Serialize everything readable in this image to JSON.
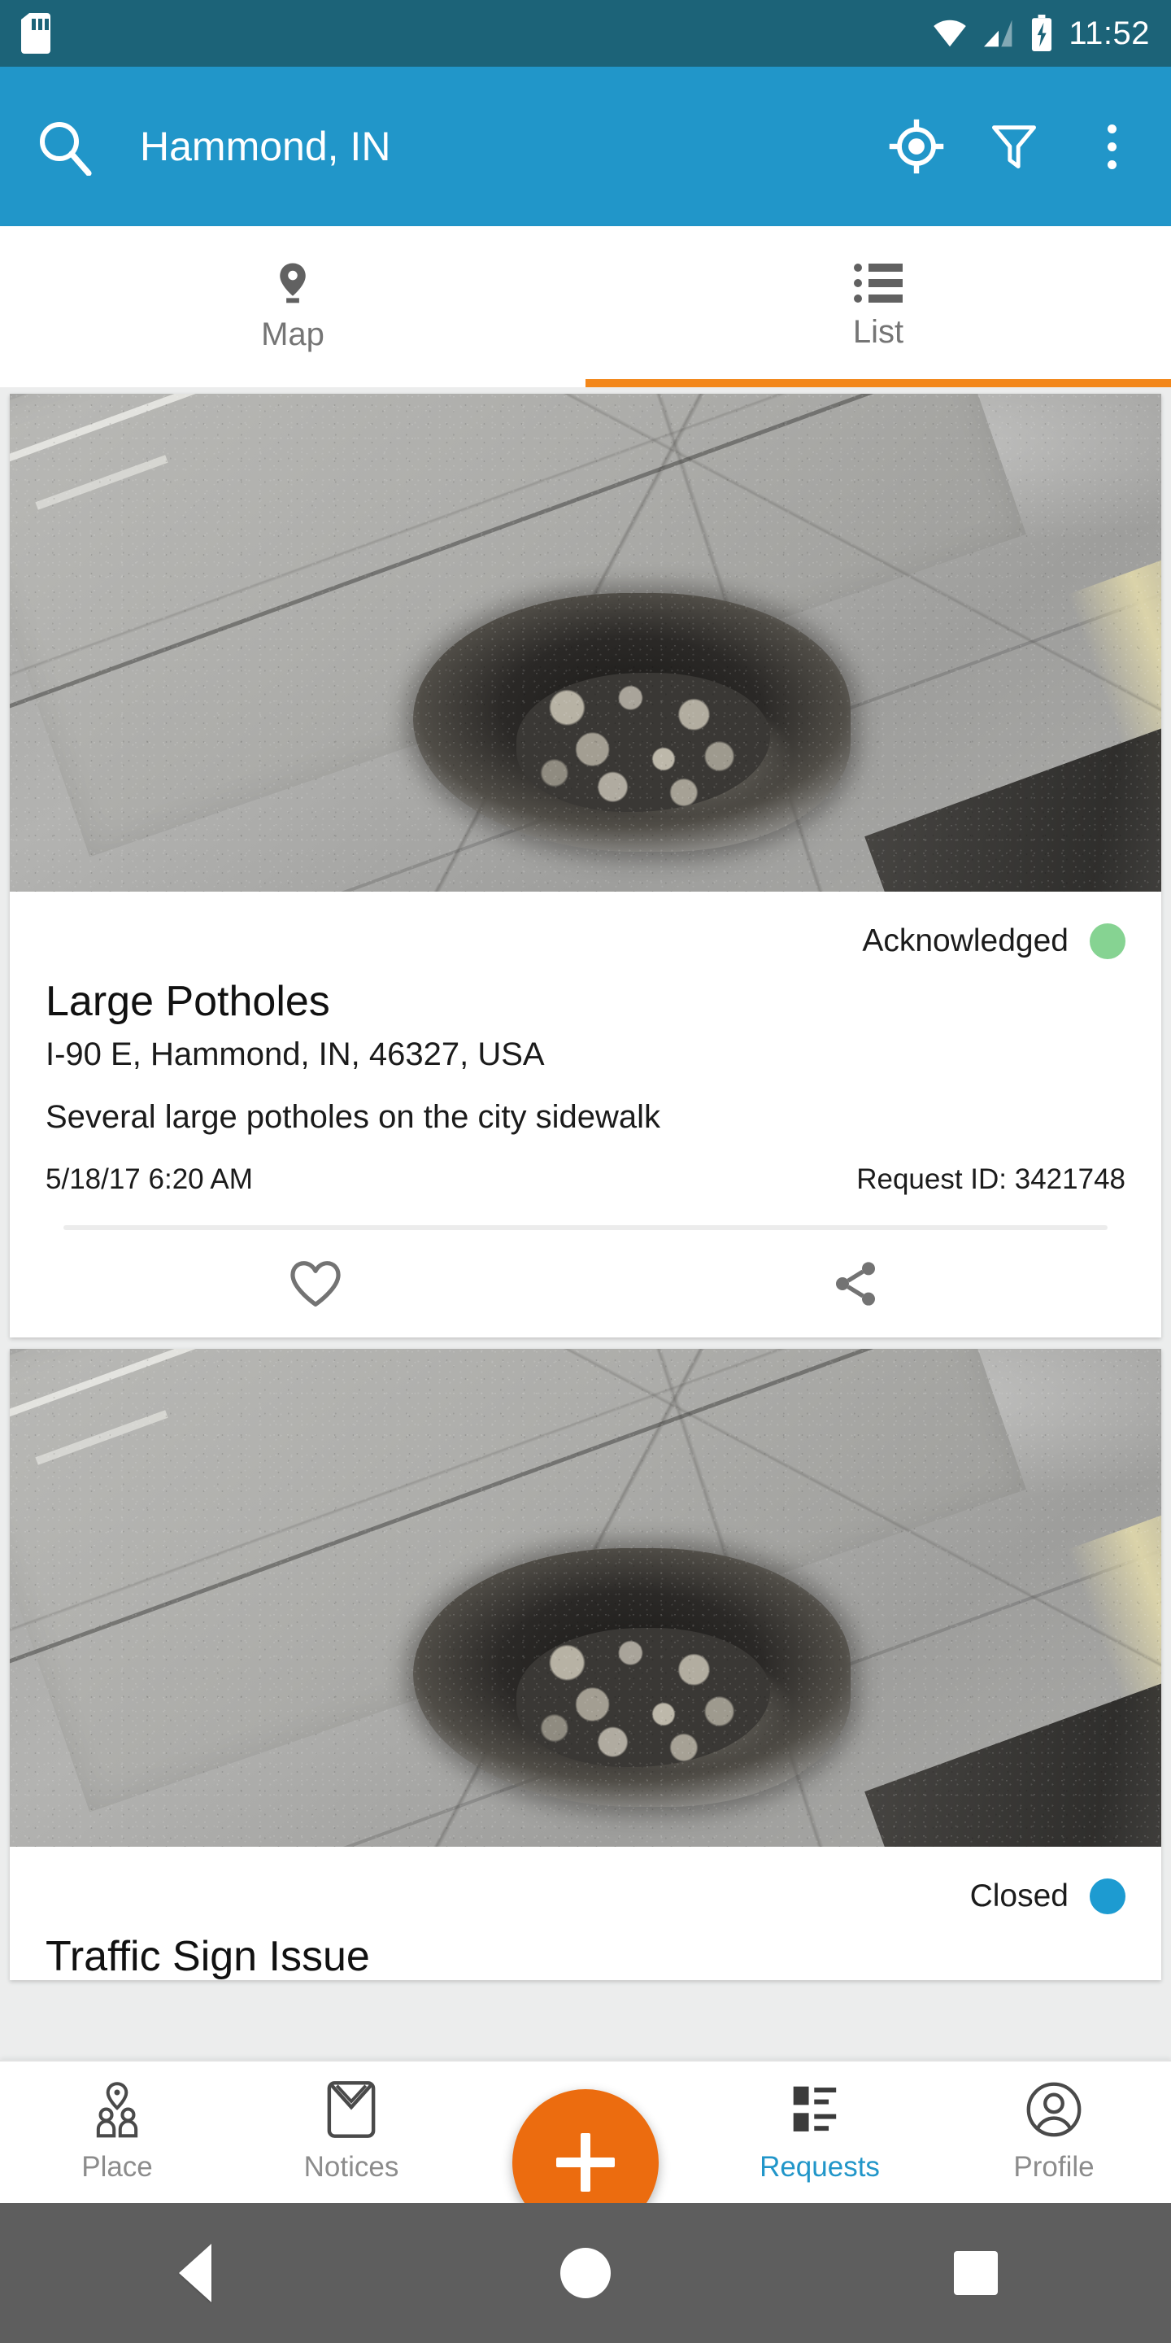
{
  "status_bar": {
    "time": "11:52",
    "icons": [
      "sd-card-icon",
      "wifi-icon",
      "cellular-signal-icon",
      "battery-charging-icon"
    ],
    "background_color": "#1c6378"
  },
  "app_bar": {
    "title": "Hammond, IN",
    "background_color": "#2196c9",
    "search_icon": "search-icon",
    "actions": [
      "my-location-icon",
      "filter-icon",
      "overflow-menu-icon"
    ]
  },
  "tabs": {
    "active_index": 1,
    "indicator_color": "#f3871a",
    "items": [
      {
        "label": "Map",
        "icon": "map-pin-icon",
        "active": false
      },
      {
        "label": "List",
        "icon": "list-icon",
        "active": true
      }
    ]
  },
  "requests": [
    {
      "status": "Acknowledged",
      "status_color": "#86d392",
      "title": "Large Potholes",
      "address": "I-90 E, Hammond, IN, 46327, USA",
      "description": "Several large potholes on the city sidewalk",
      "date": "5/18/17 6:20 AM",
      "request_id_label": "Request ID: 3421748",
      "photo_alt": "pothole-photo",
      "actions": [
        "favorite-icon",
        "share-icon"
      ]
    },
    {
      "status": "Closed",
      "status_color": "#1d9bd1",
      "title": "Traffic Sign Issue",
      "photo_alt": "pothole-photo"
    }
  ],
  "bottom_nav": {
    "active_label": "Requests",
    "active_color": "#2196c9",
    "fab": {
      "icon": "plus-icon",
      "color": "#ec6c0f"
    },
    "items": [
      {
        "label": "Place",
        "icon": "place-people-icon",
        "active": false
      },
      {
        "label": "Notices",
        "icon": "envelope-icon",
        "active": false
      },
      {
        "label": "Requests",
        "icon": "requests-list-icon",
        "active": true
      },
      {
        "label": "Profile",
        "icon": "profile-icon",
        "active": false
      }
    ]
  },
  "system_nav": {
    "background_color": "#5e5e5e",
    "buttons": [
      "back-button",
      "home-button",
      "recents-button"
    ]
  }
}
